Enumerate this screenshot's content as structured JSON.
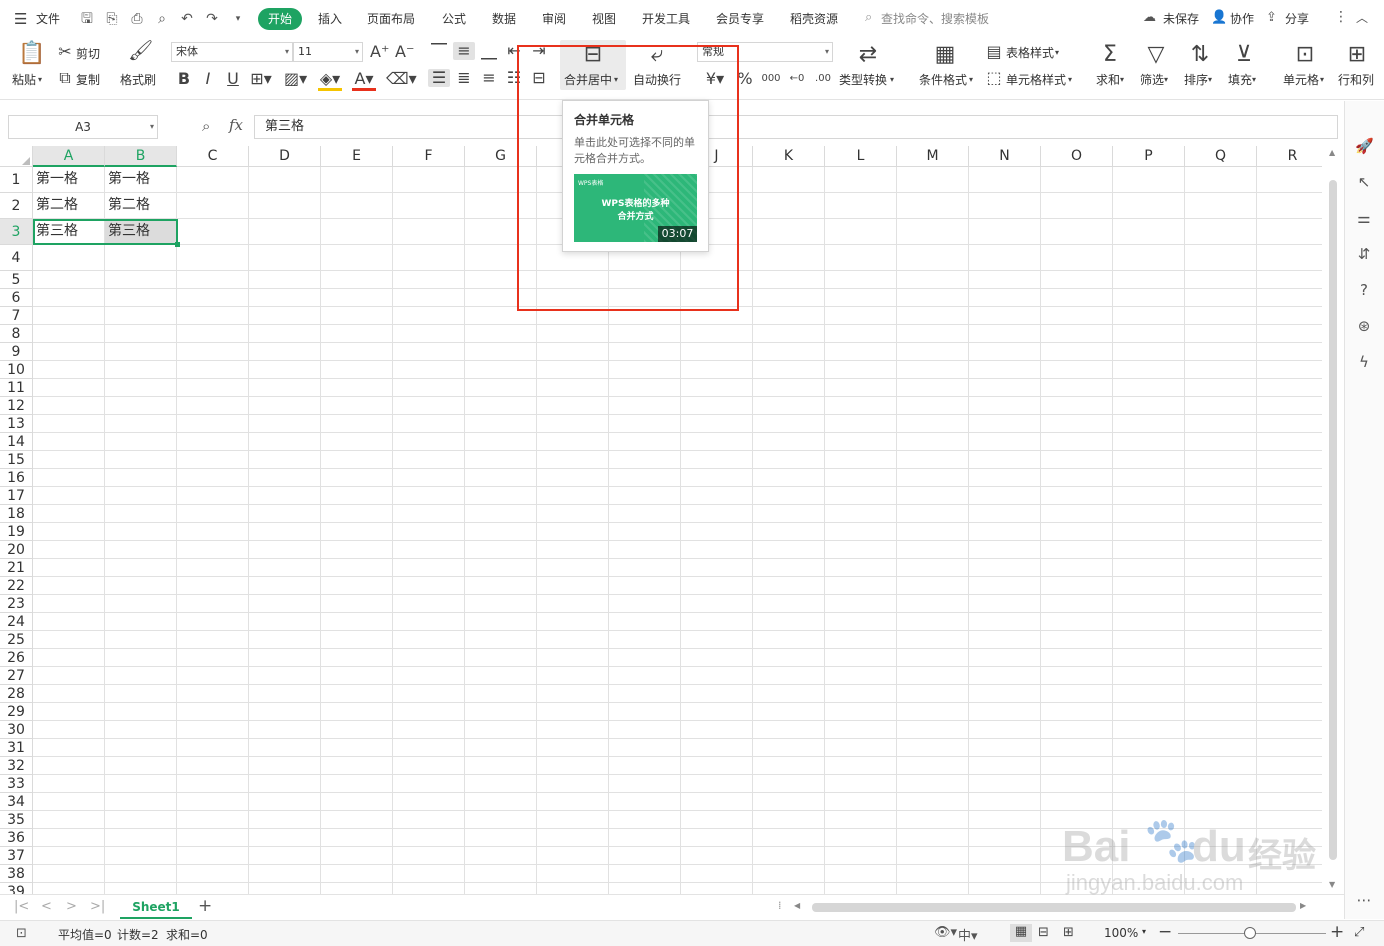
{
  "menubar": {
    "file_label": "文件",
    "tabs": [
      "开始",
      "插入",
      "页面布局",
      "公式",
      "数据",
      "审阅",
      "视图",
      "开发工具",
      "会员专享",
      "稻壳资源"
    ],
    "search_placeholder": "查找命令、搜索模板",
    "unsaved_label": "未保存",
    "collab_label": "协作",
    "share_label": "分享"
  },
  "ribbon": {
    "paste_label": "粘贴",
    "cut_label": "剪切",
    "copy_label": "复制",
    "format_painter_label": "格式刷",
    "font_name": "宋体",
    "font_size": "11",
    "merge_label": "合并居中",
    "wrap_label": "自动换行",
    "number_format": "常规",
    "type_convert_label": "类型转换",
    "cond_format_label": "条件格式",
    "table_style_label": "表格样式",
    "cell_style_label": "单元格样式",
    "sum_label": "求和",
    "filter_label": "筛选",
    "sort_label": "排序",
    "fill_label": "填充",
    "cell_label": "单元格",
    "rowcol_label": "行和列"
  },
  "formula_bar": {
    "name_box": "A3",
    "fx": "fx",
    "content": "第三格"
  },
  "grid": {
    "columns": [
      "A",
      "B",
      "C",
      "D",
      "E",
      "F",
      "G",
      "H",
      "I",
      "J",
      "K",
      "L",
      "M",
      "N",
      "O",
      "P",
      "Q",
      "R"
    ],
    "rows": [
      "1",
      "2",
      "3",
      "4",
      "5",
      "6",
      "7",
      "8",
      "9",
      "10",
      "11",
      "12",
      "13",
      "14",
      "15",
      "16",
      "17",
      "18",
      "19",
      "20",
      "21",
      "22",
      "23",
      "24",
      "25",
      "26",
      "27",
      "28",
      "29",
      "30",
      "31",
      "32",
      "33",
      "34",
      "35",
      "36",
      "37",
      "38",
      "39"
    ],
    "cells": {
      "A1": "第一格",
      "B1": "第一格",
      "A2": "第二格",
      "B2": "第二格",
      "A3": "第三格",
      "B3": "第三格"
    }
  },
  "tooltip": {
    "title": "合并单元格",
    "description": "单击此处可选择不同的单元格合并方式。",
    "video_brand": "WPS表格",
    "video_title_line1": "WPS表格的多种",
    "video_title_line2": "合并方式",
    "video_duration": "03:07"
  },
  "sheetbar": {
    "sheet_name": "Sheet1",
    "add_label": "+"
  },
  "statusbar": {
    "average": "平均值=0",
    "count": "计数=2",
    "sum": "求和=0",
    "zoom": "100%"
  },
  "colors": {
    "accent": "#1ea362",
    "highlight": "#e8311c"
  },
  "watermark": {
    "text1": "Bai",
    "text2": "du",
    "text3": "经验",
    "url": "jingyan.baidu.com"
  }
}
